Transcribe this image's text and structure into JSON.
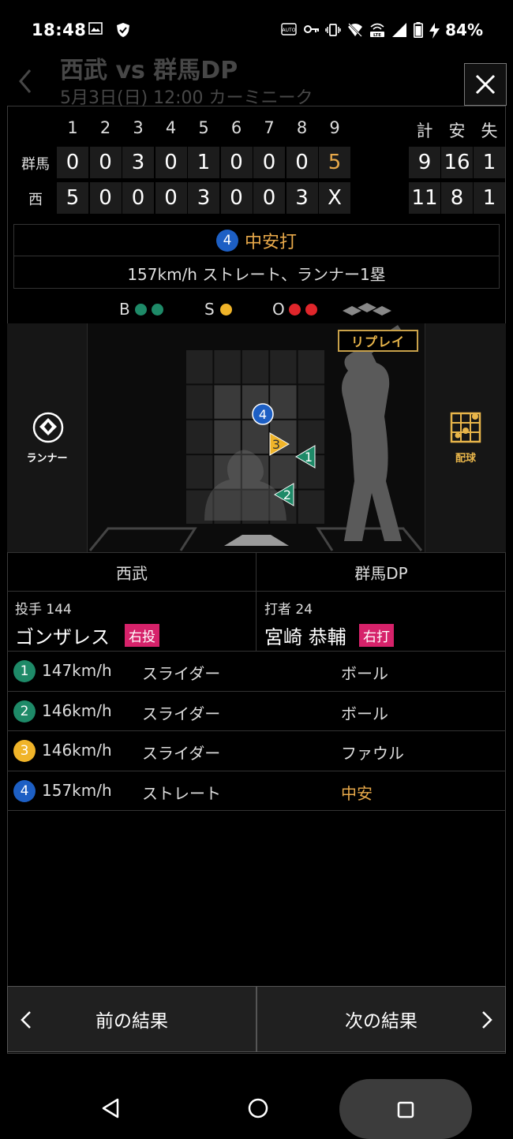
{
  "status_bar": {
    "time": "18:48",
    "battery_pct": "84%",
    "icons": [
      "image-icon",
      "shield-check-icon",
      "auto-icon",
      "key-icon",
      "vibrate-icon",
      "wifi-off-icon",
      "lte-icon",
      "signal-icon",
      "battery-icon",
      "charging-icon"
    ]
  },
  "background": {
    "title": "西武 vs 群馬DP",
    "subtitle": "5月3日(日) 12:00 カーミニーク"
  },
  "scoreboard": {
    "innings": [
      "1",
      "2",
      "3",
      "4",
      "5",
      "6",
      "7",
      "8",
      "9"
    ],
    "total_headers": [
      "計",
      "安",
      "失"
    ],
    "rows": [
      {
        "team": "群馬",
        "scores": [
          "0",
          "0",
          "3",
          "0",
          "1",
          "0",
          "0",
          "0",
          "5"
        ],
        "totals": [
          "9",
          "16",
          "1"
        ]
      },
      {
        "team": "西",
        "scores": [
          "5",
          "0",
          "0",
          "0",
          "3",
          "0",
          "0",
          "3",
          "X"
        ],
        "totals": [
          "11",
          "8",
          "1"
        ]
      }
    ]
  },
  "play": {
    "pitch_number": "4",
    "result": "中安打",
    "detail": "157km/h ストレート、ランナー1塁"
  },
  "count": {
    "ball_label": "B",
    "strike_label": "S",
    "out_label": "O",
    "balls": 2,
    "strikes": 1,
    "outs": 2
  },
  "field": {
    "runner_label": "ランナー",
    "pitch_chart_label": "配球",
    "replay_label": "リプレイ",
    "pitch_markers": [
      {
        "num": "1",
        "shape": "triangle-left",
        "color": "#1e8a68"
      },
      {
        "num": "2",
        "shape": "triangle-left",
        "color": "#1e8a68"
      },
      {
        "num": "3",
        "shape": "triangle-right",
        "color": "#f0b429"
      },
      {
        "num": "4",
        "shape": "circle",
        "color": "#1d5fc4"
      }
    ]
  },
  "teams": {
    "left": "西武",
    "right": "群馬DP"
  },
  "players": {
    "pitcher": {
      "role": "投手 144",
      "name": "ゴンザレス",
      "hand": "右投"
    },
    "batter": {
      "role": "打者 24",
      "name": "宮崎 恭輔",
      "hand": "右打"
    }
  },
  "pitches": [
    {
      "num": "1",
      "speed": "147km/h",
      "type": "スライダー",
      "result": "ボール",
      "color": "#1e8a68"
    },
    {
      "num": "2",
      "speed": "146km/h",
      "type": "スライダー",
      "result": "ボール",
      "color": "#1e8a68"
    },
    {
      "num": "3",
      "speed": "146km/h",
      "type": "スライダー",
      "result": "ファウル",
      "color": "#f0b429"
    },
    {
      "num": "4",
      "speed": "157km/h",
      "type": "ストレート",
      "result": "中安",
      "color": "#1d5fc4"
    }
  ],
  "nav": {
    "prev": "前の結果",
    "next": "次の結果"
  },
  "colors": {
    "accent_gold": "#e8a94a",
    "ball_green": "#1e8a68",
    "strike_yellow": "#f0b429",
    "out_red": "#e0262b",
    "hand_badge": "#d6226a"
  }
}
